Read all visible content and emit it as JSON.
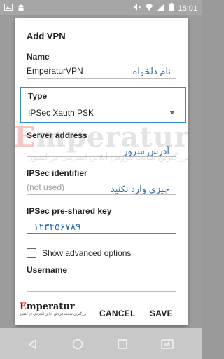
{
  "status_bar": {
    "time": "18:01"
  },
  "dialog": {
    "title": "Add VPN",
    "name": {
      "label": "Name",
      "value": "EmperaturVPN",
      "hint": "نام دلخواه"
    },
    "type": {
      "label": "Type",
      "value": "IPSec Xauth PSK"
    },
    "server_address": {
      "label": "Server address",
      "hint": "آدرس سرور"
    },
    "ipsec_identifier": {
      "label": "IPSec identifier",
      "placeholder": "(not used)",
      "hint": "چیزی وارد نکنید"
    },
    "psk": {
      "label": "IPSec pre-shared key",
      "value": "۱۲۳۴۵۶۷۸۹"
    },
    "show_advanced": {
      "label": "Show advanced options",
      "checked": false
    },
    "username": {
      "label": "Username"
    },
    "buttons": {
      "cancel": "CANCEL",
      "save": "SAVE"
    }
  },
  "watermark": {
    "brand_e": "E",
    "brand_rest": "mperatur",
    "subtitle": "بزرگترین سایت فروش آنلاین اینترنتی در کشور"
  },
  "colors": {
    "accent": "#2f8fd1",
    "hint": "#2e6bb5",
    "brand_red": "#d40000"
  },
  "icons": [
    "gallery-icon",
    "android-icon",
    "mute-icon",
    "wifi-icon",
    "signal-icon",
    "battery-icon",
    "back-icon",
    "home-icon",
    "recents-icon",
    "sim-switch-icon"
  ]
}
